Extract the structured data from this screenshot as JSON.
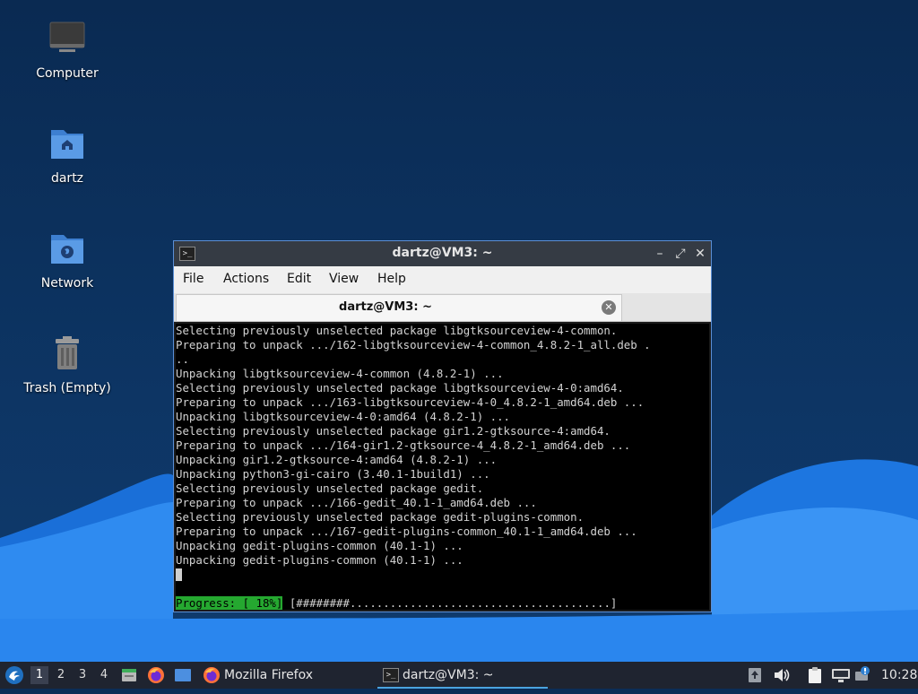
{
  "desktop": {
    "icons": [
      {
        "label": "Computer",
        "icon": "computer-icon"
      },
      {
        "label": "dartz",
        "icon": "home-folder-icon"
      },
      {
        "label": "Network",
        "icon": "network-folder-icon"
      },
      {
        "label": "Trash (Empty)",
        "icon": "trash-icon"
      }
    ]
  },
  "terminal": {
    "window_title": "dartz@VM3: ~",
    "menu": [
      "File",
      "Actions",
      "Edit",
      "View",
      "Help"
    ],
    "tab_label": "dartz@VM3: ~",
    "lines": [
      "Selecting previously unselected package libgtksourceview-4-common.",
      "Preparing to unpack .../162-libgtksourceview-4-common_4.8.2-1_all.deb .",
      "..",
      "Unpacking libgtksourceview-4-common (4.8.2-1) ...",
      "Selecting previously unselected package libgtksourceview-4-0:amd64.",
      "Preparing to unpack .../163-libgtksourceview-4-0_4.8.2-1_amd64.deb ...",
      "Unpacking libgtksourceview-4-0:amd64 (4.8.2-1) ...",
      "Selecting previously unselected package gir1.2-gtksource-4:amd64.",
      "Preparing to unpack .../164-gir1.2-gtksource-4_4.8.2-1_amd64.deb ...",
      "Unpacking gir1.2-gtksource-4:amd64 (4.8.2-1) ...",
      "Unpacking python3-gi-cairo (3.40.1-1build1) ...",
      "Selecting previously unselected package gedit.",
      "Preparing to unpack .../166-gedit_40.1-1_amd64.deb ...",
      "Selecting previously unselected package gedit-plugins-common.",
      "Preparing to unpack .../167-gedit-plugins-common_40.1-1_amd64.deb ...",
      "Unpacking gedit-plugins-common (40.1-1) ...",
      "Unpacking gedit-plugins-common (40.1-1) ..."
    ],
    "progress_label": "Progress: [ 18%]",
    "progress_bar": "[########.......................................]"
  },
  "taskbar": {
    "workspaces": [
      "1",
      "2",
      "3",
      "4"
    ],
    "firefox_label": "Mozilla Firefox",
    "terminal_label": "dartz@VM3: ~",
    "clock": "10:28"
  },
  "colors": {
    "desktop_bg": "#0b2d57",
    "progress_green": "#25a830",
    "taskbar_bg": "#1f2430",
    "accent": "#4aa3df"
  }
}
